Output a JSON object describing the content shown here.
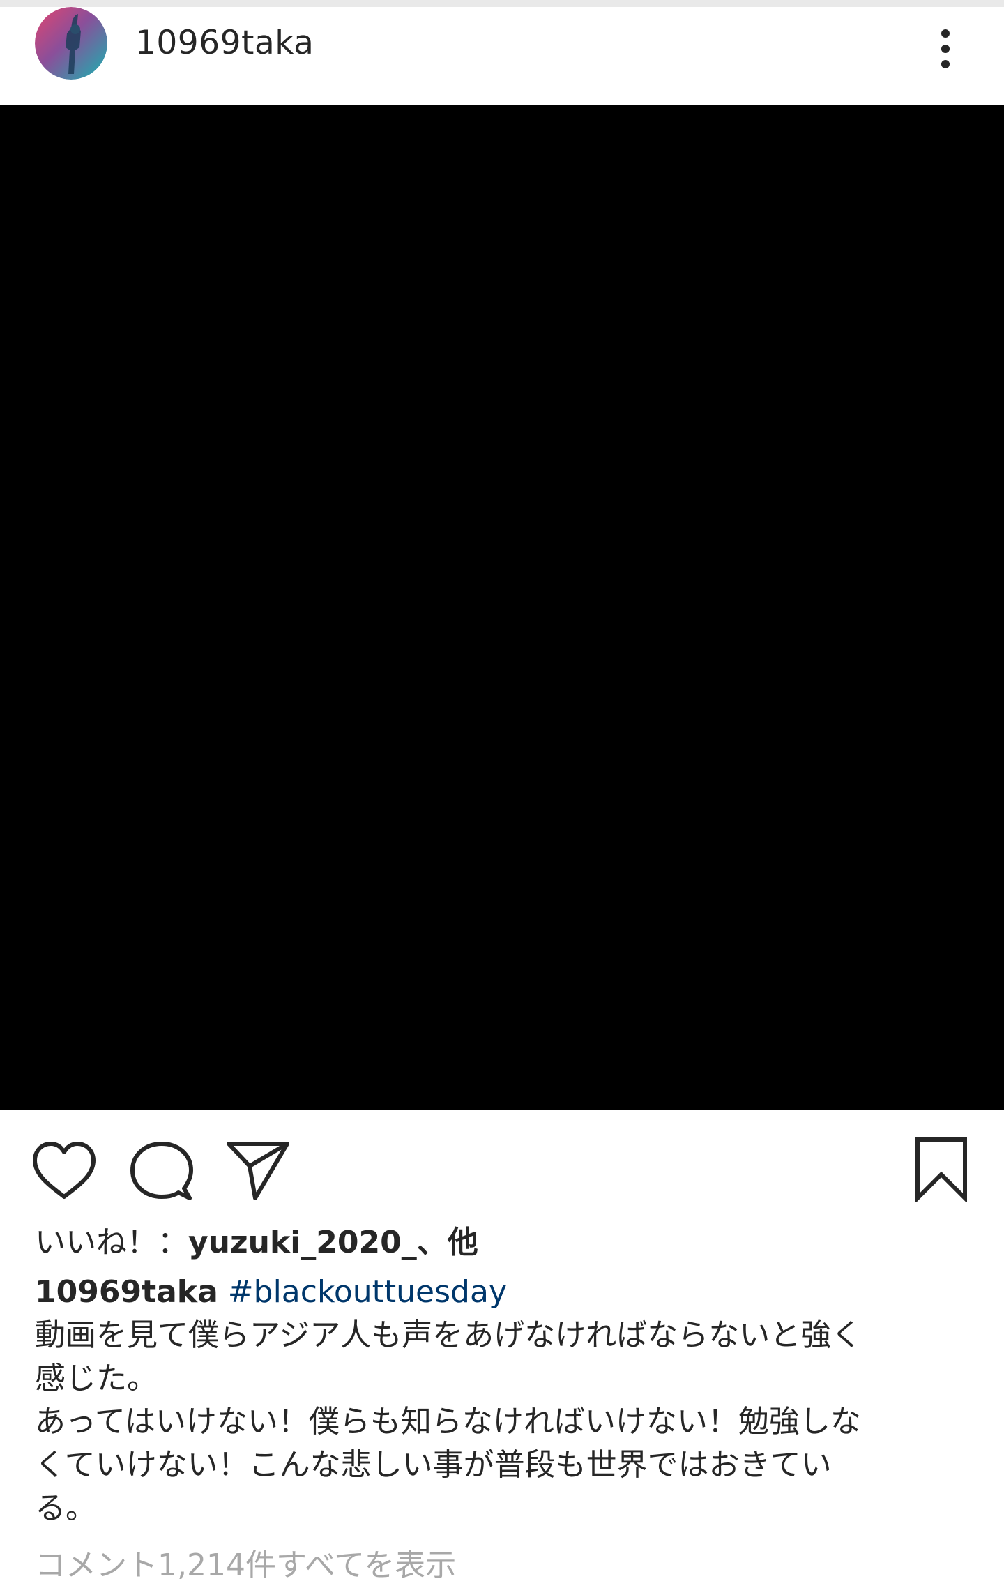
{
  "post": {
    "username": "10969taka",
    "more_icon": "more-vertical-icon",
    "image_color": "#000000"
  },
  "actions": {
    "like_icon": "heart-outline-icon",
    "comment_icon": "speech-bubble-icon",
    "share_icon": "paper-plane-icon",
    "save_icon": "bookmark-outline-icon"
  },
  "likes": {
    "prefix": "いいね！：",
    "user": "yuzuki_2020_",
    "suffix": "、他"
  },
  "caption": {
    "username": "10969taka",
    "hashtag": "#blackouttuesday",
    "text": "動画を見て僕らアジア人も声をあげなければならないと強く\n感じた。\nあってはいけない！僕らも知らなければいけない！勉強しな\nくていけない！こんな悲しい事が普段も世界ではおきてい\nる。"
  },
  "comments": {
    "view_all": "コメント1,214件すべてを表示"
  },
  "colors": {
    "text": "#262626",
    "hashtag": "#00376b",
    "muted": "#a8a8a8",
    "avatar_ring_start": "#e1306c",
    "avatar_ring_end": "#1fa8a8"
  }
}
